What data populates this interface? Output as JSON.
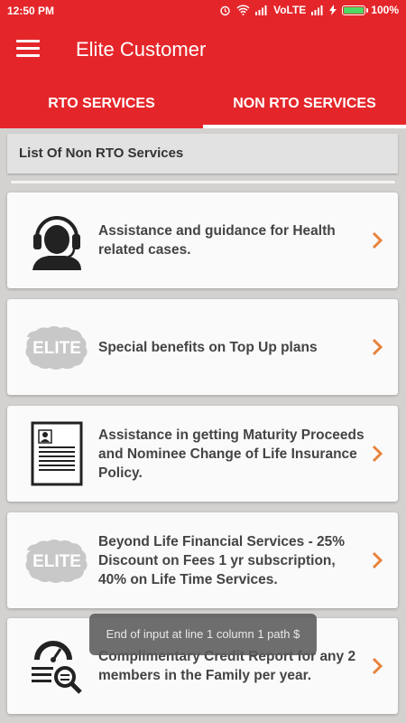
{
  "status_bar": {
    "time": "12:50 PM",
    "network": "VoLTE",
    "battery": "100%",
    "battery_level": 1.0
  },
  "app_bar": {
    "title": "Elite Customer",
    "menu_icon": "hamburger-menu-icon"
  },
  "tabs": [
    {
      "label": "RTO SERVICES",
      "active": false
    },
    {
      "label": "NON RTO SERVICES",
      "active": true
    }
  ],
  "list": {
    "header": "List Of Non RTO Services",
    "items": [
      {
        "text": "Assistance and guidance for Health related cases.",
        "icon": "customer-support-headset-icon"
      },
      {
        "text": "Special benefits on Top Up plans",
        "icon": "elite-badge-icon",
        "icon_label": "ELITE"
      },
      {
        "text": "Assistance in getting Maturity Proceeds and Nominee Change of Life Insurance Policy.",
        "icon": "document-profile-icon"
      },
      {
        "text": "Beyond Life Financial Services - 25% Discount on Fees 1 yr subscription, 40% on Life Time Services.",
        "icon": "elite-badge-icon",
        "icon_label": "ELITE"
      },
      {
        "text": "Complimentary Credit Report for any 2 members  in the Family per year.",
        "icon": "credit-score-search-icon"
      }
    ]
  },
  "toast": {
    "message": "End of input at line 1 column 1 path $"
  },
  "colors": {
    "primary": "#e4262a",
    "accent_chevron": "#e8823a",
    "background": "#d4d2d0",
    "card": "#fafafa"
  }
}
